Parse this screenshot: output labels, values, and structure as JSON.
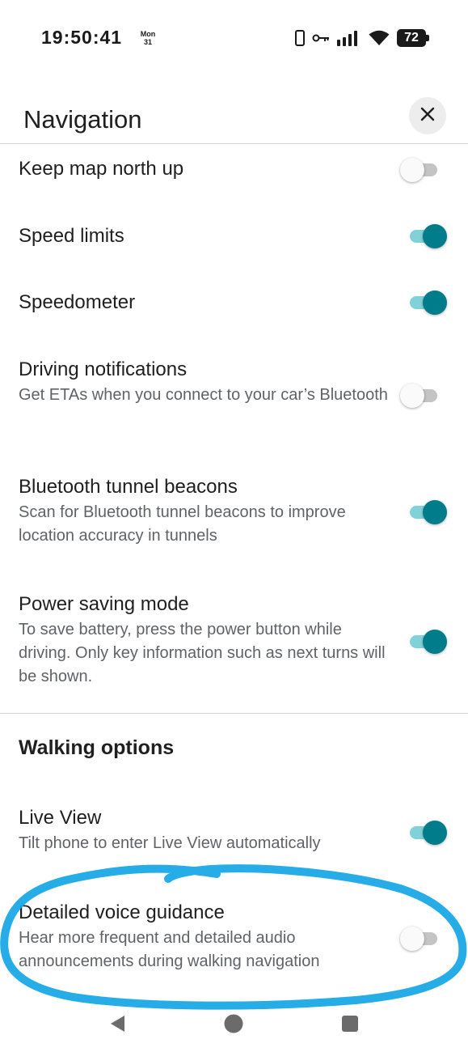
{
  "status_bar": {
    "time": "19:50:41",
    "day": "Mon",
    "date": "31",
    "battery": "72",
    "icons": [
      "phone-icon",
      "vpn-key-icon",
      "signal-icon",
      "wifi-icon",
      "battery-icon"
    ]
  },
  "header": {
    "title": "Navigation",
    "close_icon": "close-icon"
  },
  "settings": [
    {
      "label": "Keep map north up",
      "description": "",
      "enabled": false
    },
    {
      "label": "Speed limits",
      "description": "",
      "enabled": true
    },
    {
      "label": "Speedometer",
      "description": "",
      "enabled": true
    },
    {
      "label": "Driving notifications",
      "description": "Get ETAs when you connect to your car’s Bluetooth",
      "enabled": false
    },
    {
      "label": "Bluetooth tunnel beacons",
      "description": "Scan for Bluetooth tunnel beacons to improve location accuracy in tunnels",
      "enabled": true
    },
    {
      "label": "Power saving mode",
      "description": "To save battery, press the power button while driving. Only key information such as next turns will be shown.",
      "enabled": true
    }
  ],
  "walking": {
    "section_title": "Walking options",
    "items": [
      {
        "label": "Live View",
        "description": "Tilt phone to enter Live View automatically",
        "enabled": true
      },
      {
        "label": "Detailed voice guidance",
        "description": "Hear more frequent and detailed audio announcements during walking navigation",
        "enabled": false
      }
    ]
  },
  "annotation": {
    "color": "#1aa9e6"
  },
  "colors": {
    "toggle_on_thumb": "#007c8a",
    "toggle_on_track": "#80d2d8",
    "toggle_off_track": "#c4c4c4"
  },
  "nav_bar": {
    "icons": [
      "back-icon",
      "home-icon",
      "recents-icon"
    ]
  }
}
